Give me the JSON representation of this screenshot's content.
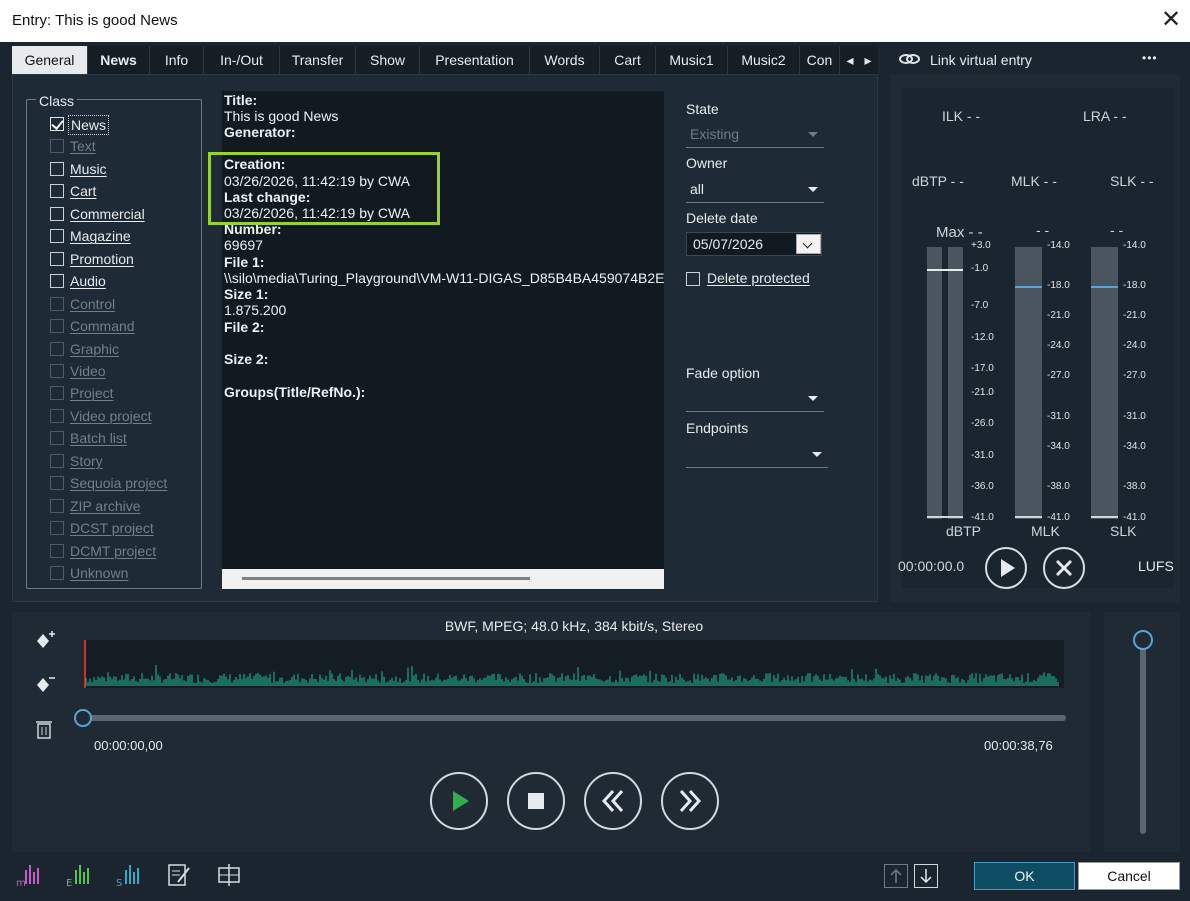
{
  "window": {
    "title": "Entry: This is good News",
    "close_glyph": "✕"
  },
  "tabs": [
    "General",
    "News",
    "Info",
    "In-/Out",
    "Transfer",
    "Show",
    "Presentation",
    "Words",
    "Cart",
    "Music1",
    "Music2",
    "Con"
  ],
  "active_tab": "General",
  "tab_scroll": {
    "left": "◂",
    "right": "▸"
  },
  "class_group": {
    "legend": "Class",
    "items": [
      {
        "label": "News",
        "checked": true,
        "enabled": true
      },
      {
        "label": "Text",
        "checked": false,
        "enabled": false
      },
      {
        "label": "Music",
        "checked": false,
        "enabled": true
      },
      {
        "label": "Cart",
        "checked": false,
        "enabled": true
      },
      {
        "label": "Commercial",
        "checked": false,
        "enabled": true
      },
      {
        "label": "Magazine",
        "checked": false,
        "enabled": true
      },
      {
        "label": "Promotion",
        "checked": false,
        "enabled": true
      },
      {
        "label": "Audio",
        "checked": false,
        "enabled": true
      },
      {
        "label": "Control",
        "checked": false,
        "enabled": false
      },
      {
        "label": "Command",
        "checked": false,
        "enabled": false
      },
      {
        "label": "Graphic",
        "checked": false,
        "enabled": false
      },
      {
        "label": "Video",
        "checked": false,
        "enabled": false
      },
      {
        "label": "Project",
        "checked": false,
        "enabled": false
      },
      {
        "label": "Video project",
        "checked": false,
        "enabled": false
      },
      {
        "label": "Batch list",
        "checked": false,
        "enabled": false
      },
      {
        "label": "Story",
        "checked": false,
        "enabled": false
      },
      {
        "label": "Sequoia project",
        "checked": false,
        "enabled": false
      },
      {
        "label": "ZIP archive",
        "checked": false,
        "enabled": false
      },
      {
        "label": "DCST project",
        "checked": false,
        "enabled": false
      },
      {
        "label": "DCMT project",
        "checked": false,
        "enabled": false
      },
      {
        "label": "Unknown",
        "checked": false,
        "enabled": false
      }
    ]
  },
  "info": {
    "title_label": "Title:",
    "title_value": "This is good News",
    "generator_label": "Generator:",
    "creation_label": "Creation:",
    "creation_value": "03/26/2026, 11:42:19 by CWA",
    "last_change_label": "Last change:",
    "last_change_value": "03/26/2026, 11:42:19 by CWA",
    "number_label": "Number:",
    "number_value": "69697",
    "file1_label": "File 1:",
    "file1_value": "\\\\silo\\media\\Turing_Playground\\VM-W11-DIGAS_D85B4BA459074B2E",
    "size1_label": "Size 1:",
    "size1_value": "1.875.200",
    "file2_label": "File 2:",
    "size2_label": "Size 2:",
    "groups_label": "Groups(Title/RefNo.):"
  },
  "form": {
    "state_label": "State",
    "state_value": "Existing",
    "owner_label": "Owner",
    "owner_value": "all",
    "delete_date_label": "Delete date",
    "delete_date_value": "05/07/2026",
    "delete_protected_label": "Delete protected",
    "fade_label": "Fade option",
    "fade_value": "",
    "endpoints_label": "Endpoints",
    "endpoints_value": ""
  },
  "loudness": {
    "header": "Link virtual entry",
    "menu_glyph": "•••",
    "il": "ILK - -",
    "lra": "LRA - -",
    "dbtp": "dBTP - -",
    "ml": "MLK - -",
    "sl": "SLK - -",
    "max": "Max - -",
    "ml_peak": "- -",
    "sl_peak": "- -",
    "dbtp_scale": [
      "+3.0",
      "-1.0",
      "-7.0",
      "-12.0",
      "-17.0",
      "-21.0",
      "-26.0",
      "-31.0",
      "-36.0",
      "-41.0"
    ],
    "lufs_scale": [
      "-14.0",
      "-18.0",
      "-21.0",
      "-24.0",
      "-27.0",
      "-31.0",
      "-34.0",
      "-38.0",
      "-41.0"
    ],
    "col_dbtp": "dBTP",
    "col_ml": "MLK",
    "col_sl": "SLK",
    "time": "00:00:00.0",
    "unit": "LUFS"
  },
  "player": {
    "format": "BWF, MPEG; 48.0 kHz, 384 kbit/s, Stereo",
    "start_time": "00:00:00,00",
    "end_time": "00:00:38,76",
    "position_fraction": 0.0
  },
  "footer": {
    "ok": "OK",
    "cancel": "Cancel"
  },
  "colors": {
    "accent": "#9bd12c",
    "wave": "#1fa385",
    "ok_bg": "#0e4c63"
  }
}
